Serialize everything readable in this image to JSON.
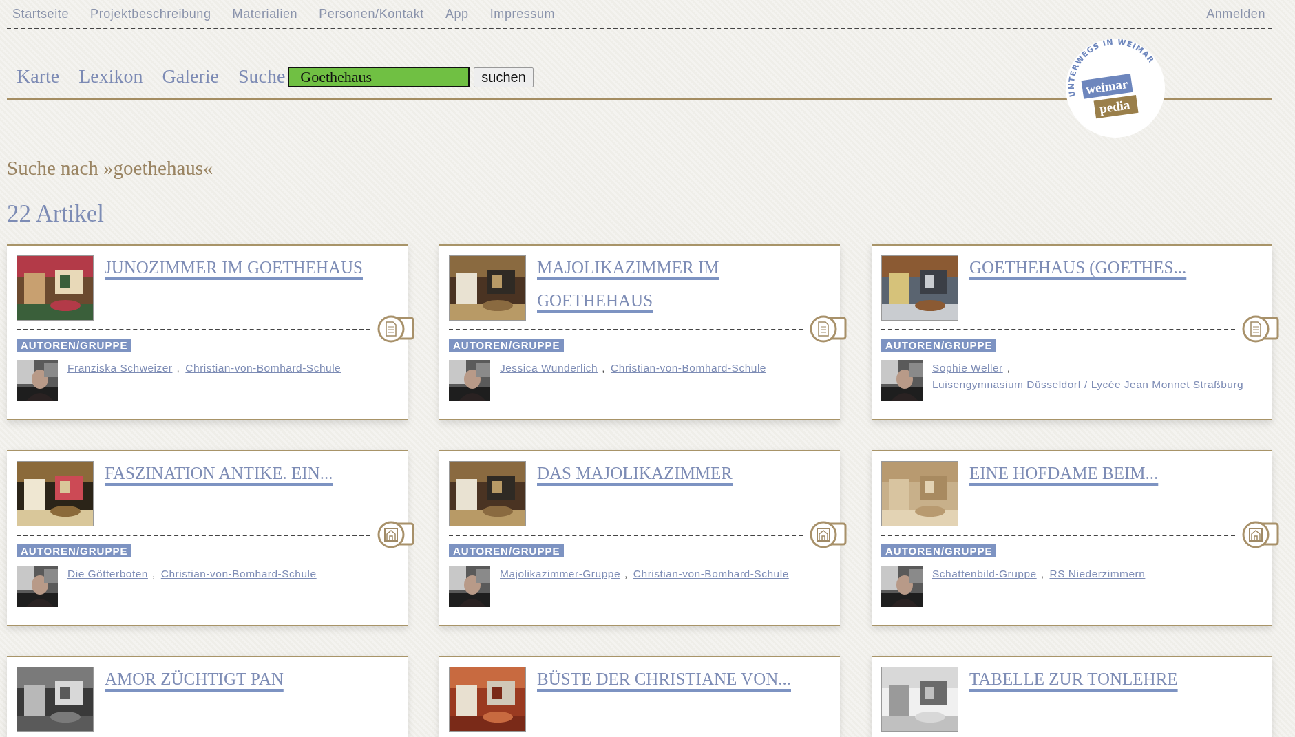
{
  "top_nav": {
    "items": [
      {
        "label": "Startseite"
      },
      {
        "label": "Projektbeschreibung"
      },
      {
        "label": "Materialien"
      },
      {
        "label": "Personen/Kontakt"
      },
      {
        "label": "App"
      },
      {
        "label": "Impressum"
      }
    ],
    "login": "Anmelden"
  },
  "main_nav": {
    "items": [
      {
        "label": "Karte"
      },
      {
        "label": "Lexikon"
      },
      {
        "label": "Galerie"
      }
    ],
    "search_label": "Suche",
    "search_value": "Goethehaus",
    "search_button": "suchen"
  },
  "logo": {
    "ring_text": "UNTERWEGS IN WEIMAR",
    "word_1": "weimar",
    "word_2": "pedia"
  },
  "heading": "Suche nach »goethehaus«",
  "result_count": "22 Artikel",
  "cards": [
    {
      "title": "JUNOZIMMER IM GOETHEHAUS",
      "kind": "text",
      "authors_label": "AUTOREN/GRUPPE",
      "authors": [
        "Franziska Schweizer",
        "Christian-von-Bomhard-Schule"
      ],
      "separator": ","
    },
    {
      "title": "MAJOLIKAZIMMER IM GOETHEHAUS",
      "kind": "text",
      "authors_label": "AUTOREN/GRUPPE",
      "authors": [
        "Jessica Wunderlich",
        "Christian-von-Bomhard-Schule"
      ],
      "separator": ","
    },
    {
      "title": "GOETHEHAUS (GOETHES...",
      "kind": "text",
      "authors_label": "AUTOREN/GRUPPE",
      "authors": [
        "Sophie Weller",
        "Luisengymnasium Düsseldorf / Lycée Jean Monnet Straßburg"
      ],
      "separator": ","
    },
    {
      "title": "FASZINATION ANTIKE. EIN...",
      "authors_label": "AUTOREN/GRUPPE",
      "authors": [
        "Die Götterboten",
        "Christian-von-Bomhard-Schule"
      ],
      "separator": ","
    },
    {
      "title": "DAS MAJOLIKAZIMMER",
      "authors_label": "AUTOREN/GRUPPE",
      "authors": [
        "Majolikazimmer-Gruppe",
        "Christian-von-Bomhard-Schule"
      ],
      "separator": ","
    },
    {
      "title": "EINE HOFDAME BEIM...",
      "authors_label": "AUTOREN/GRUPPE",
      "authors": [
        "Schattenbild-Gruppe",
        "RS Niederzimmern"
      ],
      "separator": ","
    },
    {
      "title": "AMOR ZÜCHTIGT PAN"
    },
    {
      "title": "BÜSTE DER CHRISTIANE VON..."
    },
    {
      "title": "TABELLE ZUR TONLEHRE"
    }
  ]
}
